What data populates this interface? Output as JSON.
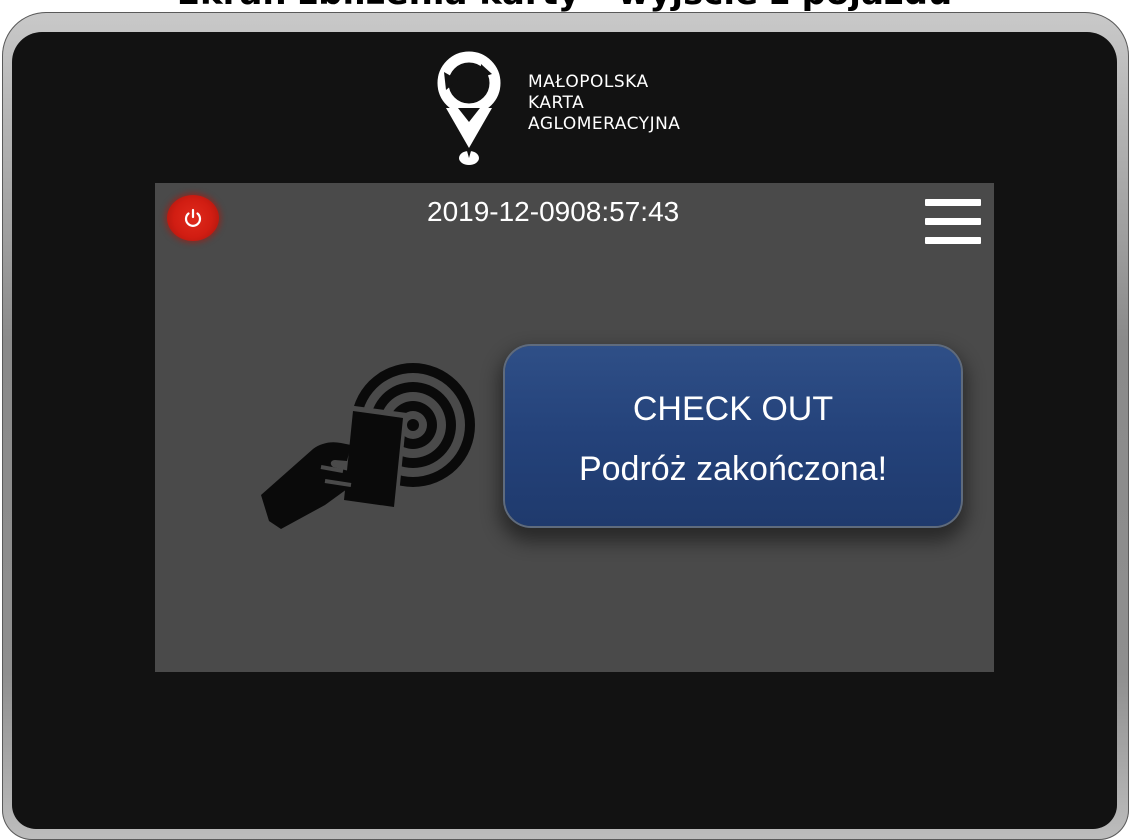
{
  "header": {
    "heading": "Ekran zbliżenia karty - wyjście z pojazdu"
  },
  "logo": {
    "lines": [
      "MAŁOPOLSKA",
      "KARTA",
      "AGLOMERACYJNA"
    ]
  },
  "screen": {
    "date": "2019-12-09",
    "time": "08:57:43",
    "status_title": "CHECK OUT",
    "status_message": "Podróż zakończona!"
  },
  "icons": {
    "power": "power-icon",
    "menu": "hamburger-menu-icon",
    "tap": "contactless-card-tap-icon",
    "logo": "location-pin-logo-icon"
  },
  "colors": {
    "screen_background": "#4a4a4a",
    "device_bezel": "#121212",
    "power_button": "#d11d12",
    "status_panel": "#24427a",
    "text": "#ffffff"
  }
}
